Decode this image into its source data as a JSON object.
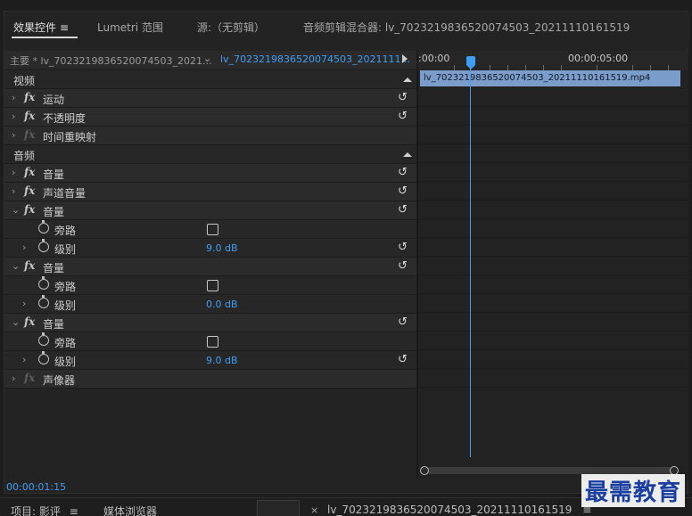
{
  "tabs": [
    {
      "label": "效果控件",
      "menu": "≡"
    },
    {
      "label": "Lumetri 范围"
    },
    {
      "label": "源:（无剪辑）"
    },
    {
      "label": "音频剪辑混合器: lv_7023219836520074503_20211110161519"
    }
  ],
  "source": {
    "main": "主要 * lv_7023219836520074503_2021...",
    "clip": "lv_7023219836520074503_2021111..."
  },
  "sections": {
    "video": "视频",
    "audio": "音频"
  },
  "effects": {
    "motion": "运动",
    "opacity": "不透明度",
    "time_remap": "时间重映射",
    "volume": "音量",
    "channel_volume": "声道音量",
    "panner": "声像器"
  },
  "params": {
    "bypass": "旁路",
    "level": "级别",
    "level_values": [
      "9.0 dB",
      "0.0 dB",
      "9.0 dB"
    ]
  },
  "fx_symbol": "fx",
  "timeline": {
    "tc_start": ":00:00",
    "tc_mid": "00:00:05:00",
    "clip_name": "lv_7023219836520074503_20211110161519.mp4"
  },
  "footer": {
    "timecode": "00:00:01:15"
  },
  "bottom_tabs": {
    "project": "项目: 影评",
    "project_menu": "≡",
    "media_browser": "媒体浏览器",
    "close": "×",
    "sequence": "lv_7023219836520074503_20211110161519",
    "sequence_menu": "≡"
  },
  "watermark": "最需教育",
  "colors": {
    "accent": "#3f9df4",
    "clip": "#7a9dcc",
    "panel": "#232323"
  }
}
